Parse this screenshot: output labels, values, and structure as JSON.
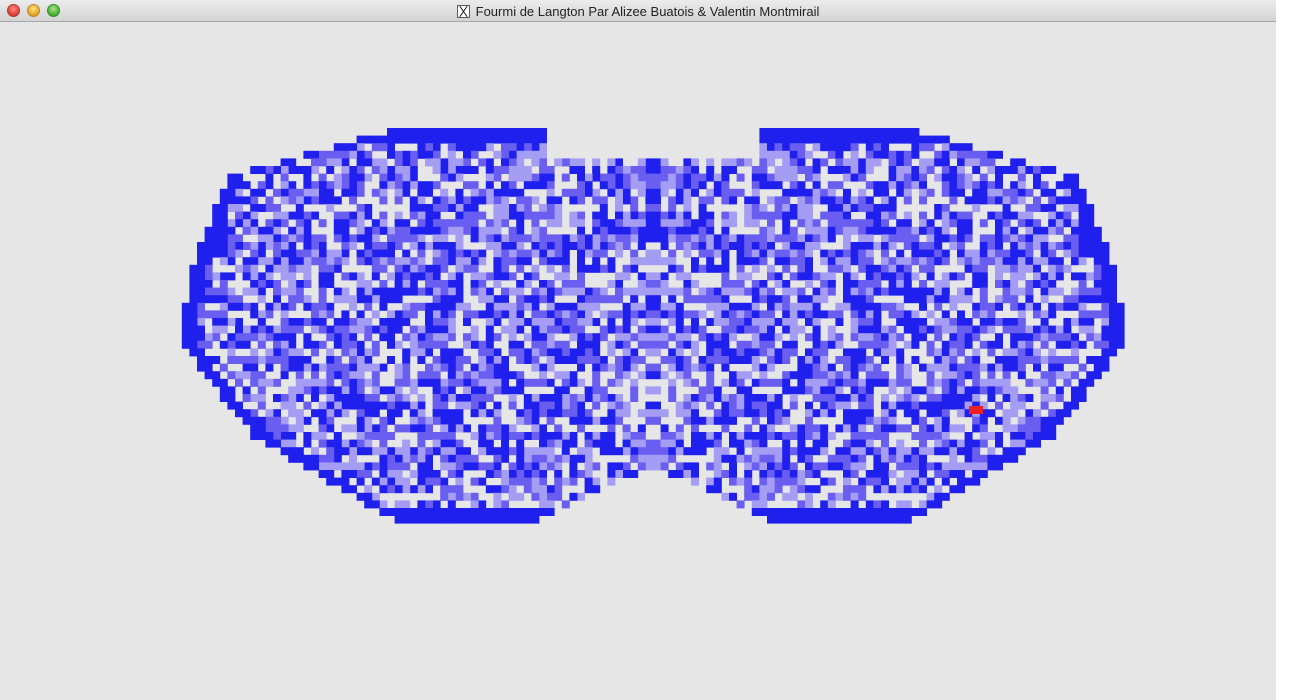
{
  "window": {
    "title": "Fourmi de Langton Par Alizee Buatois & Valentin Montmirail",
    "app_icon": "x11-icon"
  },
  "controls": {
    "close": "close-button",
    "minimize": "minimize-button",
    "zoom": "zoom-button"
  },
  "colors": {
    "background": "#e6e6e6",
    "state_dark": "#2020ee",
    "state_mid": "#6a5ef0",
    "state_light": "#a59cf4",
    "ant": "#ee2020"
  }
}
